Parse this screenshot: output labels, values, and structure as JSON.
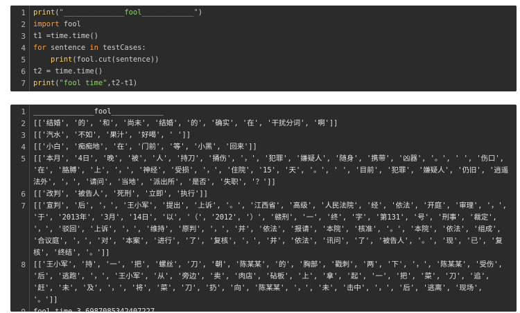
{
  "code_cell": {
    "line_numbers": [
      "1",
      "2",
      "3",
      "4",
      "5",
      "6",
      "7"
    ],
    "lines": [
      {
        "parts": [
          {
            "cls": "fn",
            "text": "print"
          },
          {
            "cls": "dim",
            "text": "("
          },
          {
            "cls": "str",
            "text": "\"______________fool____________\""
          },
          {
            "cls": "dim",
            "text": ")"
          }
        ]
      },
      {
        "parts": [
          {
            "cls": "kw",
            "text": "import"
          },
          {
            "cls": "dim",
            "text": " fool"
          }
        ]
      },
      {
        "parts": [
          {
            "cls": "dim",
            "text": "t1 =time.time()"
          }
        ]
      },
      {
        "parts": [
          {
            "cls": "kw",
            "text": "for"
          },
          {
            "cls": "dim",
            "text": " sentence "
          },
          {
            "cls": "kw",
            "text": "in"
          },
          {
            "cls": "dim",
            "text": " testCases:"
          }
        ]
      },
      {
        "parts": [
          {
            "cls": "dim",
            "text": "    "
          },
          {
            "cls": "fn",
            "text": "print"
          },
          {
            "cls": "dim",
            "text": "(fool.cut(sentence))"
          }
        ]
      },
      {
        "parts": [
          {
            "cls": "dim",
            "text": "t2 = time.time()"
          }
        ]
      },
      {
        "parts": [
          {
            "cls": "fn",
            "text": "print"
          },
          {
            "cls": "dim",
            "text": "("
          },
          {
            "cls": "str",
            "text": "\"fool time\""
          },
          {
            "cls": "dim",
            "text": ",t2-t1)"
          }
        ]
      }
    ]
  },
  "output_cell": {
    "lines": [
      {
        "num": "1",
        "text": "______________fool____________"
      },
      {
        "num": "2",
        "text": "[['结婚', '的', '和', '尚未', '结婚', '的', '确实', '在', '干扰分词', '啊']]"
      },
      {
        "num": "3",
        "text": "[['汽水', '不如', '果汁', '好喝', ' ']]"
      },
      {
        "num": "4",
        "text": "[['小白', '痴痴地', '在', '门前', '等', '小黑', '回来']]"
      },
      {
        "num": "5",
        "text": "[['本月', '4日', '晚', '被', '人', '持刀', '捅伤', '，', '犯罪', '嫌疑人', '随身', '携带', '凶器', '。', ' ', '伤口', '在', '胳膊', '上', '，', '神经', '受损', '，', '住院', '15', '天', '。', ' ', '目前', '犯罪', '嫌疑人', '仍旧', '逍遥法外', '，', '请问', '当地', '派出所', '是否', '失职', '？']]"
      },
      {
        "num": "6",
        "text": "[['改判', '被告人', '死刑', '立即', '执行']]"
      },
      {
        "num": "7",
        "text": "[['宣判', '后', '，', '王小军', '提出', '上诉', '。', '江西省', '高级', '人民法院', '经', '依法', '开庭', '审理', '，', '于', '2013年', '3月', '14日', '以', '（', '2012', '）', '赣刑', '一', '终', '字', '第131', '号', '刑事', '裁定', '，', '驳回', '上诉', '，', '维持', '原判', '，', '并', '依法', '报请', '本院', '核准', '。', '本院', '依法', '组成', '合议庭', '，', '对', '本案', '进行', '了', '复核', '，', '并', '依法', '讯问', '了', '被告人', '。', '现', '已', '复核', '终结', '。']]"
      },
      {
        "num": "8",
        "text": "[['王小军', '持', '一', '把', '螺丝', '刀', '朝', '陈某某', '的', '胸部', '戳刺', '两', '下', '，', '陈某某', '受伤', '后', '逃跑', '，', '王小军', '从', '旁边', '卖', '肉店', '砧板', '上', '拿', '起', '一', '把', '菜', '刀', '追', '赶', '未', '及', '，', '将', '菜', '刀', '扔', '向', '陈某某', '，', '未', '击中', '，', '后', '逃离', '现场', '。']]"
      },
      {
        "num": "9",
        "text": "fool time 3.6987085342407227"
      }
    ]
  }
}
